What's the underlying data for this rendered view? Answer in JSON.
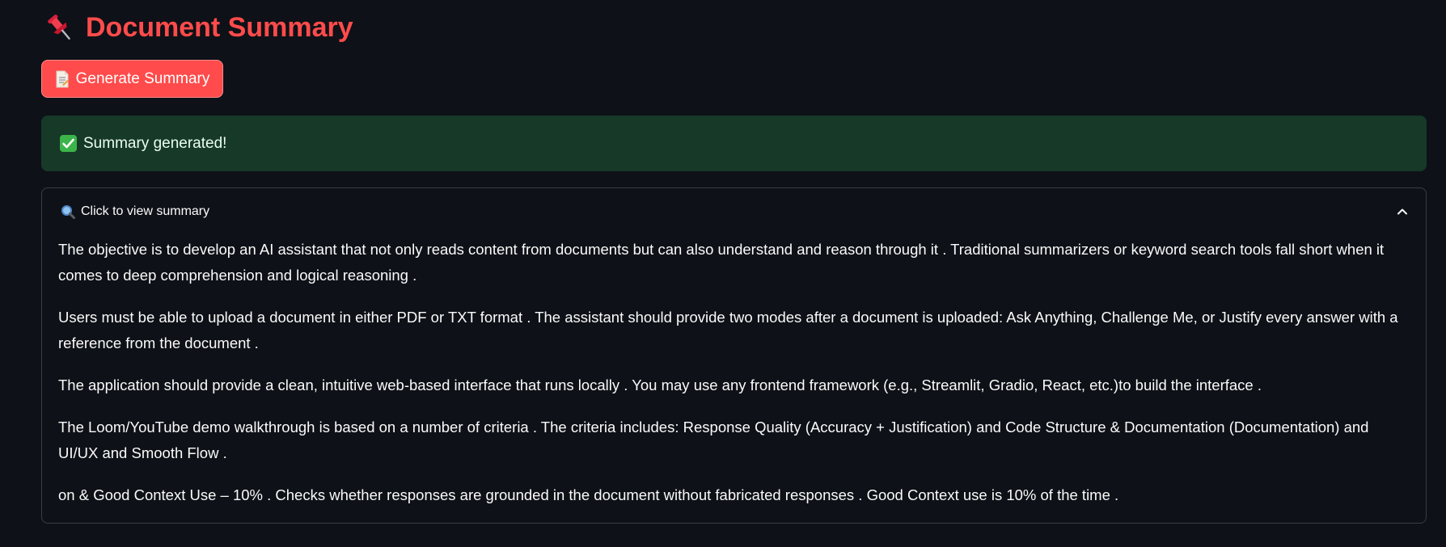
{
  "header": {
    "icon": "pushpin-icon",
    "title": "Document Summary"
  },
  "generate_button": {
    "icon": "document-icon",
    "label": "Generate Summary"
  },
  "status": {
    "icon": "check-mark-icon",
    "message": "Summary generated!"
  },
  "expander": {
    "icon": "magnifier-icon",
    "label": "Click to view summary",
    "expanded": true,
    "paragraphs": [
      "The objective is to develop an AI assistant that not only reads content from documents but can also understand and reason through it . Traditional summarizers or keyword search tools fall short when it comes to deep comprehension and logical reasoning .",
      "Users must be able to upload a document in either PDF or TXT format . The assistant should provide two modes after a document is uploaded: Ask Anything, Challenge Me, or Justify every answer with a reference from the document .",
      "The application should provide a clean, intuitive web-based interface that runs locally . You may use any frontend framework (e.g., Streamlit, Gradio, React, etc.)to build the interface .",
      "The Loom/YouTube demo walkthrough is based on a number of criteria . The criteria includes: Response Quality (Accuracy + Justification) and Code Structure & Documentation (Documentation) and UI/UX and Smooth Flow .",
      "on & Good Context Use – 10% . Checks whether responses are grounded in the document without fabricated responses . Good Context use is 10% of the time ."
    ]
  },
  "colors": {
    "background": "#0e1117",
    "accent": "#ff4b4b",
    "success_bg": "#173928",
    "border": "#3a3d45"
  }
}
